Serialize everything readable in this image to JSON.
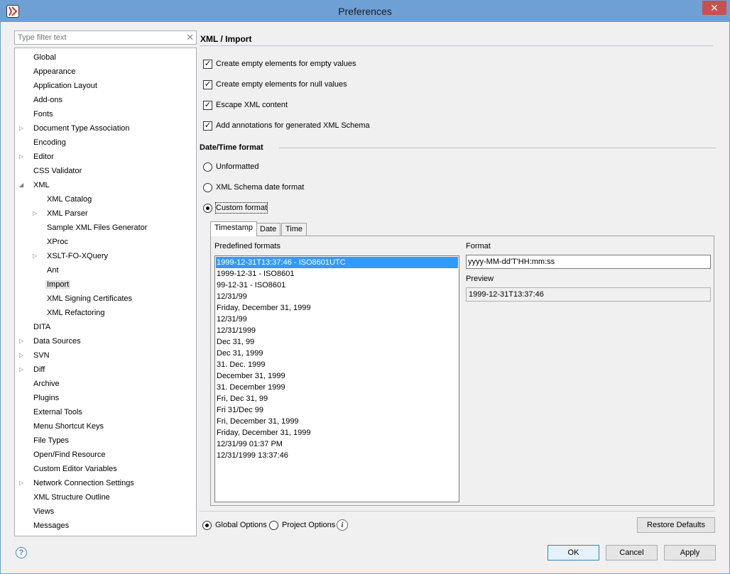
{
  "window": {
    "title": "Preferences",
    "close_glyph": "✕"
  },
  "filter": {
    "placeholder": "Type filter text",
    "clear_glyph": "✕"
  },
  "tree": [
    {
      "label": "Global",
      "level": 0,
      "arrow": ""
    },
    {
      "label": "Appearance",
      "level": 0,
      "arrow": ""
    },
    {
      "label": "Application Layout",
      "level": 0,
      "arrow": ""
    },
    {
      "label": "Add-ons",
      "level": 0,
      "arrow": ""
    },
    {
      "label": "Fonts",
      "level": 0,
      "arrow": ""
    },
    {
      "label": "Document Type Association",
      "level": 0,
      "arrow": "▷"
    },
    {
      "label": "Encoding",
      "level": 0,
      "arrow": ""
    },
    {
      "label": "Editor",
      "level": 0,
      "arrow": "▷"
    },
    {
      "label": "CSS Validator",
      "level": 0,
      "arrow": ""
    },
    {
      "label": "XML",
      "level": 0,
      "arrow": "◢"
    },
    {
      "label": "XML Catalog",
      "level": 1,
      "arrow": ""
    },
    {
      "label": "XML Parser",
      "level": 1,
      "arrow": "▷"
    },
    {
      "label": "Sample XML Files Generator",
      "level": 1,
      "arrow": ""
    },
    {
      "label": "XProc",
      "level": 1,
      "arrow": ""
    },
    {
      "label": "XSLT-FO-XQuery",
      "level": 1,
      "arrow": "▷"
    },
    {
      "label": "Ant",
      "level": 1,
      "arrow": ""
    },
    {
      "label": "Import",
      "level": 1,
      "arrow": "",
      "selected": true
    },
    {
      "label": "XML Signing Certificates",
      "level": 1,
      "arrow": ""
    },
    {
      "label": "XML Refactoring",
      "level": 1,
      "arrow": ""
    },
    {
      "label": "DITA",
      "level": 0,
      "arrow": ""
    },
    {
      "label": "Data Sources",
      "level": 0,
      "arrow": "▷"
    },
    {
      "label": "SVN",
      "level": 0,
      "arrow": "▷"
    },
    {
      "label": "Diff",
      "level": 0,
      "arrow": "▷"
    },
    {
      "label": "Archive",
      "level": 0,
      "arrow": ""
    },
    {
      "label": "Plugins",
      "level": 0,
      "arrow": ""
    },
    {
      "label": "External Tools",
      "level": 0,
      "arrow": ""
    },
    {
      "label": "Menu Shortcut Keys",
      "level": 0,
      "arrow": ""
    },
    {
      "label": "File Types",
      "level": 0,
      "arrow": ""
    },
    {
      "label": "Open/Find Resource",
      "level": 0,
      "arrow": ""
    },
    {
      "label": "Custom Editor Variables",
      "level": 0,
      "arrow": ""
    },
    {
      "label": "Network Connection Settings",
      "level": 0,
      "arrow": "▷"
    },
    {
      "label": "XML Structure Outline",
      "level": 0,
      "arrow": ""
    },
    {
      "label": "Views",
      "level": 0,
      "arrow": ""
    },
    {
      "label": "Messages",
      "level": 0,
      "arrow": ""
    }
  ],
  "page": {
    "title": "XML / Import",
    "checkboxes": [
      {
        "label": "Create empty elements for empty values",
        "checked": true
      },
      {
        "label": "Create empty elements for null values",
        "checked": true
      },
      {
        "label": "Escape XML content",
        "checked": true
      },
      {
        "label": "Add annotations for generated XML Schema",
        "checked": true
      }
    ],
    "datetime_title": "Date/Time format",
    "radios": [
      {
        "label": "Unformatted",
        "selected": false
      },
      {
        "label": "XML Schema date format",
        "selected": false
      },
      {
        "label": "Custom format",
        "selected": true
      }
    ],
    "tabs": [
      "Timestamp",
      "Date",
      "Time"
    ],
    "predefined_label": "Predefined formats",
    "formats": [
      "1999-12-31T13:37:46 - ISO8601UTC",
      "1999-12-31 - ISO8601",
      "99-12-31 - ISO8601",
      "12/31/99",
      "Friday, December 31, 1999",
      "12/31/99",
      "12/31/1999",
      "Dec 31, 99",
      "Dec 31, 1999",
      "31. Dec. 1999",
      "December 31, 1999",
      "31. December 1999",
      "Fri, Dec 31, 99",
      "Fri 31/Dec 99",
      "Fri, December 31, 1999",
      "Friday, December 31, 1999",
      "12/31/99 01:37 PM",
      "12/31/1999 13:37:46"
    ],
    "format_label": "Format",
    "format_value": "yyyy-MM-dd'T'HH:mm:ss",
    "preview_label": "Preview",
    "preview_value": "1999-12-31T13:37:46"
  },
  "bottom": {
    "global_options": "Global Options",
    "project_options": "Project Options",
    "restore_defaults": "Restore Defaults",
    "ok": "OK",
    "cancel": "Cancel",
    "apply": "Apply",
    "help_glyph": "?",
    "info_glyph": "i"
  },
  "colors": {
    "titlebar": "#6ea0d6",
    "close": "#c75050",
    "selection": "#3399ff"
  }
}
